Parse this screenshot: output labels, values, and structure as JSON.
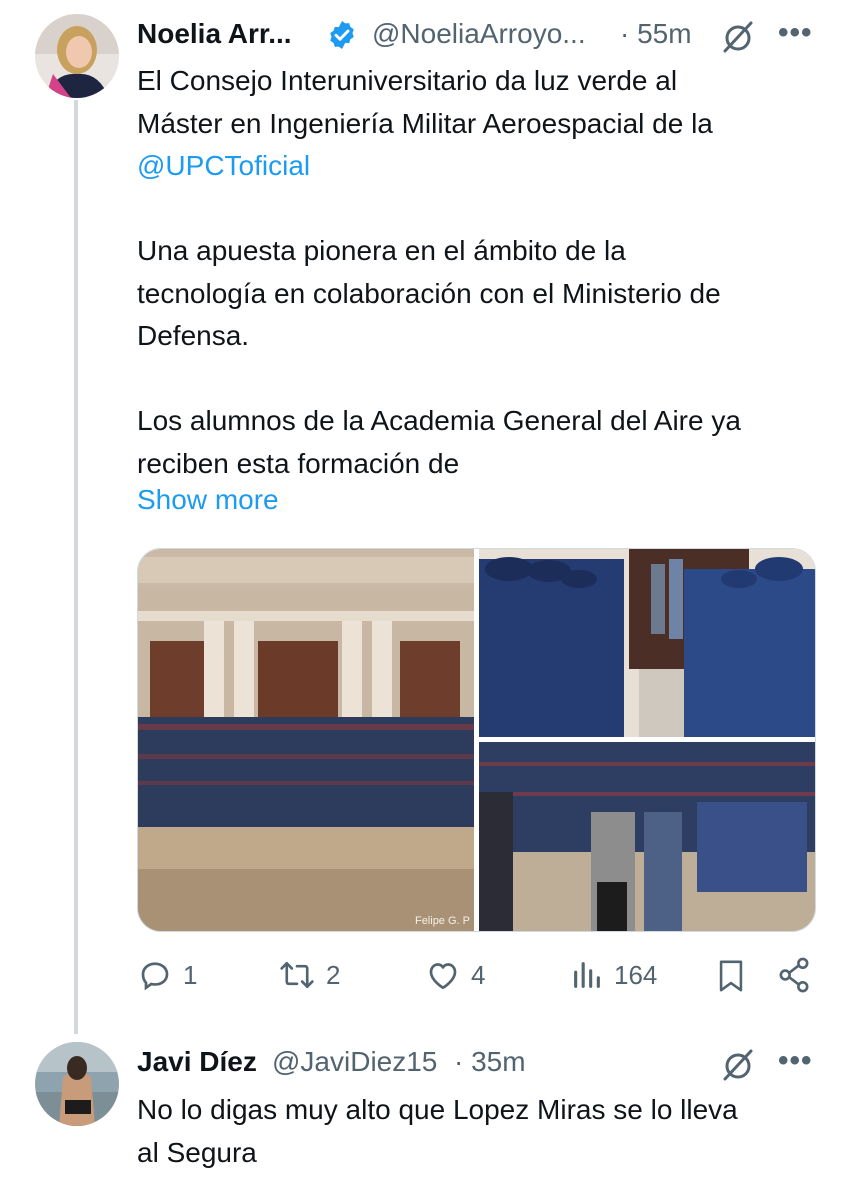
{
  "tweet": {
    "author_name": "Noelia Arr...",
    "handle": "@NoeliaArroyo...",
    "time": "· 55m",
    "lines": [
      "El Consejo Interuniversitario da luz verde al",
      "Máster en Ingeniería Militar Aeroespacial de la"
    ],
    "mention": "@UPCToficial",
    "para2": [
      "Una apuesta pionera en el ámbito de la",
      "tecnología en colaboración con el Ministerio de",
      "Defensa."
    ],
    "para3": [
      "Los alumnos de la Academia General del Aire ya",
      "reciben esta formación de"
    ],
    "show_more": "Show more",
    "photo_credit": "Felipe G. P",
    "actions": {
      "replies": "1",
      "retweets": "2",
      "likes": "4",
      "views": "164"
    }
  },
  "reply": {
    "author_name": "Javi Díez",
    "handle": "@JaviDiez15",
    "time": "· 35m",
    "lines": [
      "No lo digas muy alto que Lopez Miras se lo lleva",
      "al Segura"
    ]
  },
  "icons": {
    "verified": "verified-badge-icon",
    "grok": "grok-icon",
    "more": "more-icon",
    "reply": "reply-icon",
    "retweet": "retweet-icon",
    "like": "like-icon",
    "views": "views-icon",
    "bookmark": "bookmark-icon",
    "share": "share-icon"
  },
  "colors": {
    "link": "#1d9bf0",
    "secondary_text": "#536471",
    "thread_line": "#cfd9de"
  }
}
